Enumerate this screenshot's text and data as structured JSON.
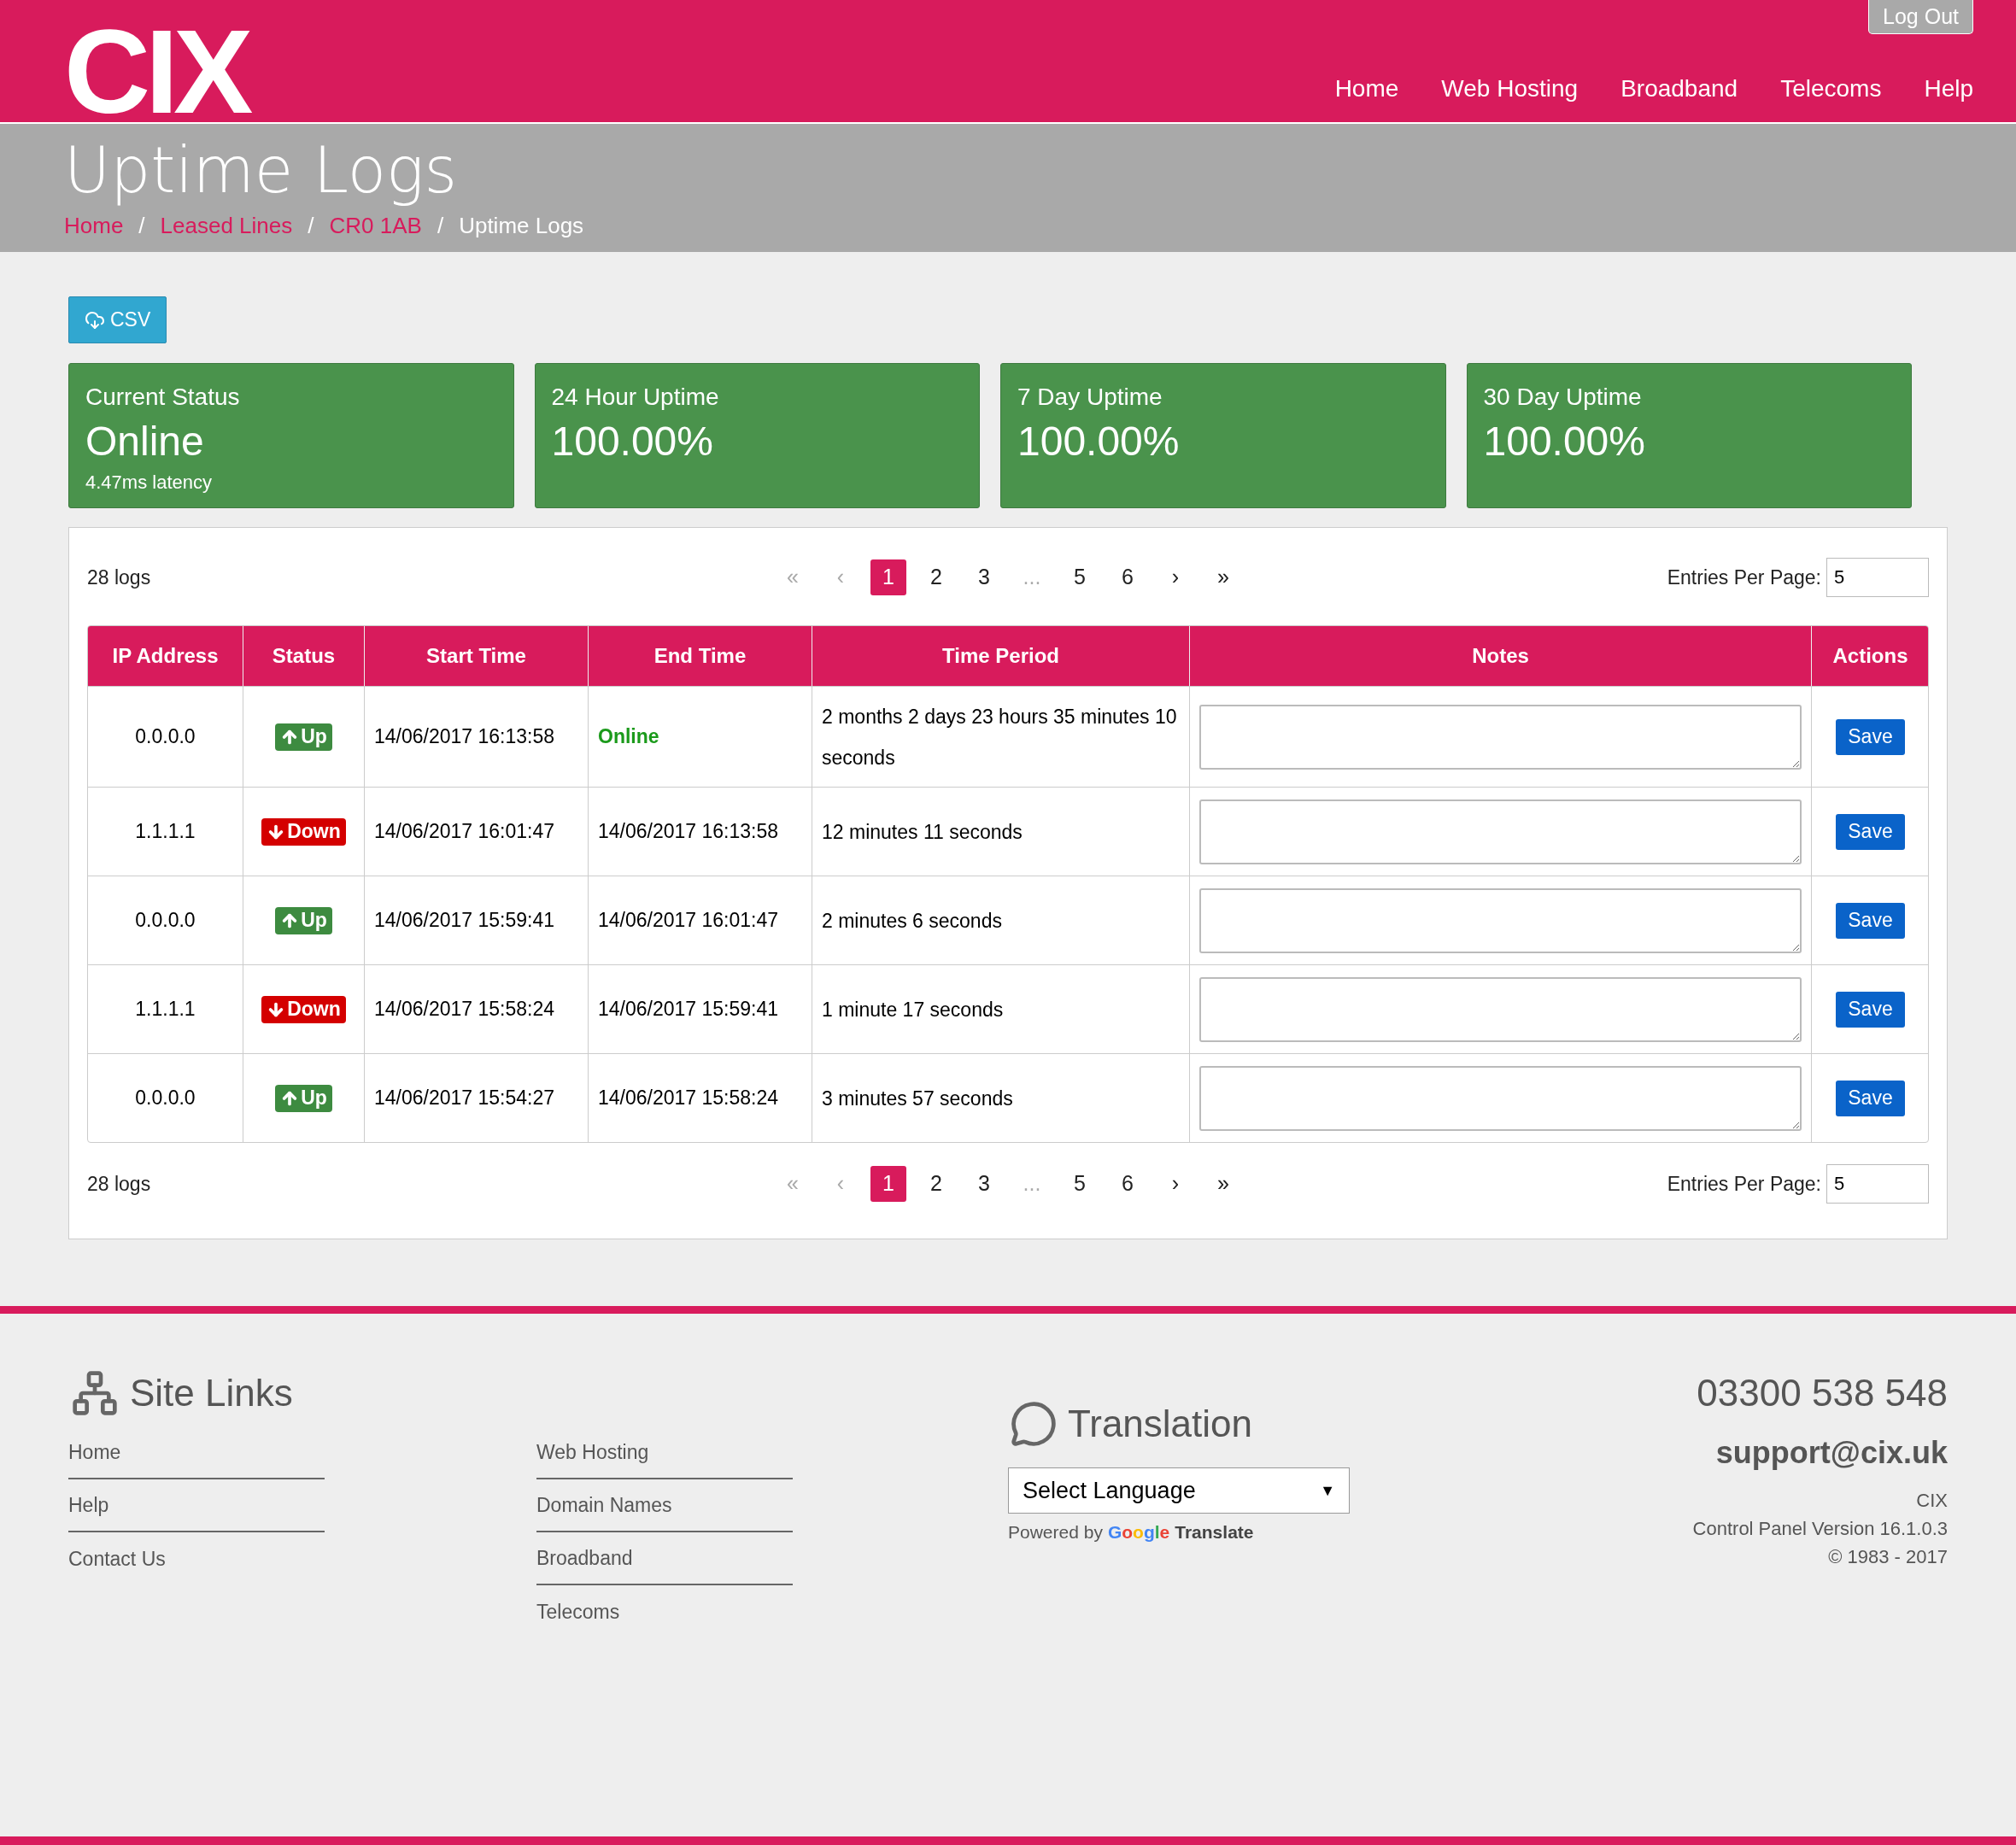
{
  "header": {
    "logo": "CIX",
    "logout": "Log Out",
    "nav": [
      {
        "label": "Home"
      },
      {
        "label": "Web Hosting"
      },
      {
        "label": "Broadband"
      },
      {
        "label": "Telecoms"
      },
      {
        "label": "Help"
      }
    ]
  },
  "page": {
    "title": "Uptime Logs",
    "breadcrumbs": [
      {
        "label": "Home",
        "current": false
      },
      {
        "label": "Leased Lines",
        "current": false
      },
      {
        "label": "CR0 1AB",
        "current": false
      },
      {
        "label": "Uptime Logs",
        "current": true
      }
    ],
    "separator": "/"
  },
  "csv_button": "CSV",
  "cards": [
    {
      "label": "Current Status",
      "value": "Online",
      "note": "4.47ms latency"
    },
    {
      "label": "24 Hour Uptime",
      "value": "100.00%"
    },
    {
      "label": "7 Day Uptime",
      "value": "100.00%"
    },
    {
      "label": "30 Day Uptime",
      "value": "100.00%"
    }
  ],
  "top_bar": {
    "count": "28 logs",
    "entries_label": "Entries Per Page:",
    "entries_value": "5",
    "pagination": [
      {
        "label": "«",
        "selected": false,
        "disabled": true
      },
      {
        "label": "‹",
        "selected": false,
        "disabled": true
      },
      {
        "label": "1",
        "selected": true,
        "disabled": false
      },
      {
        "label": "2",
        "selected": false,
        "disabled": false
      },
      {
        "label": "3",
        "selected": false,
        "disabled": false
      },
      {
        "label": "...",
        "selected": false,
        "disabled": true
      },
      {
        "label": "5",
        "selected": false,
        "disabled": false
      },
      {
        "label": "6",
        "selected": false,
        "disabled": false
      },
      {
        "label": "›",
        "selected": false,
        "disabled": false
      },
      {
        "label": "»",
        "selected": false,
        "disabled": false
      }
    ]
  },
  "bottom_bar": {
    "count": "28 logs",
    "entries_label": "Entries Per Page:",
    "entries_value": "5",
    "pagination": [
      {
        "label": "«",
        "selected": false,
        "disabled": true
      },
      {
        "label": "‹",
        "selected": false,
        "disabled": true
      },
      {
        "label": "1",
        "selected": true,
        "disabled": false
      },
      {
        "label": "2",
        "selected": false,
        "disabled": false
      },
      {
        "label": "3",
        "selected": false,
        "disabled": false
      },
      {
        "label": "...",
        "selected": false,
        "disabled": true
      },
      {
        "label": "5",
        "selected": false,
        "disabled": false
      },
      {
        "label": "6",
        "selected": false,
        "disabled": false
      },
      {
        "label": "›",
        "selected": false,
        "disabled": false
      },
      {
        "label": "»",
        "selected": false,
        "disabled": false
      }
    ]
  },
  "table": {
    "columns": [
      "IP Address",
      "Status",
      "Start Time",
      "End Time",
      "Time Period",
      "Notes",
      "Actions"
    ],
    "rows": [
      {
        "ip": "0.0.0.0",
        "status": {
          "kind": "up",
          "label": "Up"
        },
        "start": "14/06/2017 16:13:58",
        "end": {
          "kind": "online",
          "text": "Online"
        },
        "period": "2 months 2 days 23 hours 35 minutes 10 seconds",
        "action": "Save"
      },
      {
        "ip": "1.1.1.1",
        "status": {
          "kind": "down",
          "label": "Down"
        },
        "start": "14/06/2017 16:01:47",
        "end": {
          "kind": "time",
          "text": "14/06/2017 16:13:58"
        },
        "period": "12 minutes 11 seconds",
        "action": "Save"
      },
      {
        "ip": "0.0.0.0",
        "status": {
          "kind": "up",
          "label": "Up"
        },
        "start": "14/06/2017 15:59:41",
        "end": {
          "kind": "time",
          "text": "14/06/2017 16:01:47"
        },
        "period": "2 minutes 6 seconds",
        "action": "Save"
      },
      {
        "ip": "1.1.1.1",
        "status": {
          "kind": "down",
          "label": "Down"
        },
        "start": "14/06/2017 15:58:24",
        "end": {
          "kind": "time",
          "text": "14/06/2017 15:59:41"
        },
        "period": "1 minute 17 seconds",
        "action": "Save"
      },
      {
        "ip": "0.0.0.0",
        "status": {
          "kind": "up",
          "label": "Up"
        },
        "start": "14/06/2017 15:54:27",
        "end": {
          "kind": "time",
          "text": "14/06/2017 15:58:24"
        },
        "period": "3 minutes 57 seconds",
        "action": "Save"
      }
    ]
  },
  "footer": {
    "site_links": {
      "title": "Site Links",
      "columns": [
        [
          "Home",
          "Help",
          "Contact Us"
        ],
        [
          "Web Hosting",
          "Domain Names",
          "Broadband",
          "Telecoms"
        ]
      ]
    },
    "translation": {
      "title": "Translation",
      "select": "Select Language",
      "select_caret": "▼",
      "powered_by": "Powered by",
      "google": "Google",
      "translate": "Translate"
    },
    "contact": {
      "phone": "03300 538 548",
      "email": "support@cix.uk",
      "company": "CIX",
      "version": "Control Panel Version 16.1.0.3",
      "copyright": "© 1983 - 2017"
    }
  }
}
